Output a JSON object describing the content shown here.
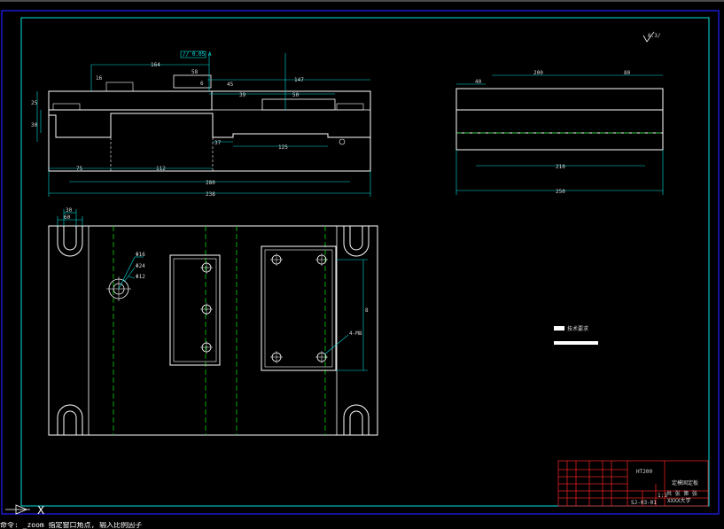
{
  "drawing": {
    "side_view_dims": {
      "d_238": "238",
      "d_280": "280",
      "d_75": "75",
      "d_112": "112",
      "d_37": "37",
      "d_125": "125",
      "d_164": "164",
      "d_147": "147",
      "d_58": "58",
      "d_39": "39",
      "d_16": "16",
      "d_25": "25",
      "d_30": "30",
      "d_45": "45",
      "d_6": "6",
      "d_50": "50",
      "flatness": "// 0.05 A"
    },
    "end_view_dims": {
      "d_250": "250",
      "d_210": "210",
      "d_200": "200",
      "d_80": "80",
      "d_40": "40"
    },
    "plan_view_dims": {
      "d_30": "30",
      "d_60": "60",
      "hole_1": "Φ16",
      "hole_2": "Φ24",
      "hole_3": "Φ12",
      "tap": "4-M8",
      "d_vert": "8"
    },
    "roughness": "6.3/",
    "tech_req_title": "技术要求",
    "title_block": {
      "material": "HT200",
      "part_name": "定模固定板",
      "scale": "1:1",
      "drawing_no": "SJ-03-01",
      "sheet": "共 张 第 张",
      "school": "XXXX大学"
    }
  },
  "command_line": {
    "text": "命令: _zoom 指定窗口角点, 输入比例因子"
  },
  "ucs_label": "X"
}
